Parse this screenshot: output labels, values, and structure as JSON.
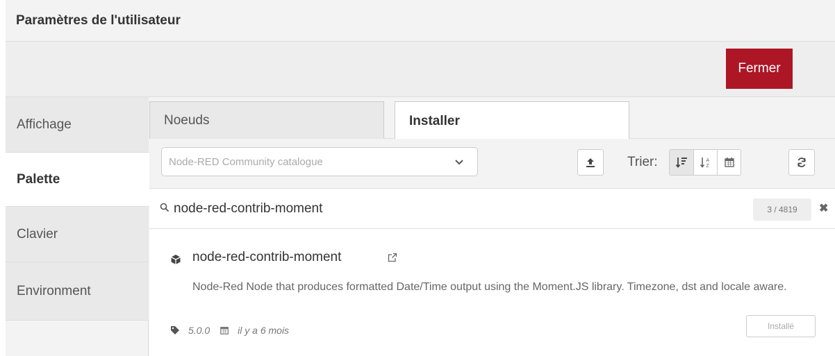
{
  "dialog": {
    "title": "Paramètres de l'utilisateur",
    "close_label": "Fermer"
  },
  "sidebar": {
    "items": [
      {
        "label": "Affichage",
        "active": false
      },
      {
        "label": "Palette",
        "active": true
      },
      {
        "label": "Clavier",
        "active": false
      },
      {
        "label": "Environment",
        "active": false
      }
    ]
  },
  "tabs": [
    {
      "label": "Noeuds",
      "active": false
    },
    {
      "label": "Installer",
      "active": true
    }
  ],
  "filter": {
    "catalogue": "Node-RED Community catalogue",
    "sort_label": "Trier:",
    "sort_options": [
      "sort-relevance-icon",
      "sort-alpha-icon",
      "sort-date-icon"
    ],
    "sort_selected": "sort-relevance-icon"
  },
  "search": {
    "value": "node-red-contrib-moment",
    "count": "3 / 4819"
  },
  "result": {
    "name": "node-red-contrib-moment",
    "description": "Node-Red Node that produces formatted Date/Time output using the Moment.JS library. Timezone, dst and locale aware.",
    "version": "5.0.0",
    "updated": "il y a 6 mois",
    "status_label": "Installé"
  },
  "colors": {
    "accent": "#ad1625",
    "panel": "#f3f3f3",
    "border": "#dddddd"
  }
}
